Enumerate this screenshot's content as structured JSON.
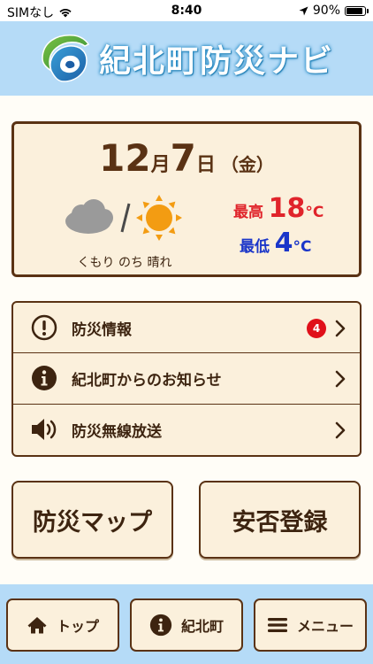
{
  "status_bar": {
    "carrier": "SIMなし",
    "time": "8:40",
    "battery": "90%",
    "battery_level": 0.9
  },
  "header": {
    "title": "紀北町防災ナビ"
  },
  "weather": {
    "month": "12",
    "month_suffix": "月",
    "day": "7",
    "day_suffix": "日",
    "weekday": "（金）",
    "description": "くもり のち 晴れ",
    "high_label": "最高",
    "high_value": "18",
    "high_unit": "°C",
    "low_label": "最低",
    "low_value": "4",
    "low_unit": "°C",
    "icons": [
      "cloud-icon",
      "sun-icon"
    ]
  },
  "menu": {
    "items": [
      {
        "label": "防災情報",
        "icon": "exclamation-circle-icon",
        "badge": "4"
      },
      {
        "label": "紀北町からのお知らせ",
        "icon": "info-circle-icon"
      },
      {
        "label": "防災無線放送",
        "icon": "speaker-icon"
      }
    ]
  },
  "buttons": {
    "map": "防災マップ",
    "safety": "安否登録"
  },
  "footer": {
    "top": "トップ",
    "town": "紀北町",
    "menu": "メニュー"
  },
  "colors": {
    "header_bg": "#b5dbf7",
    "border_brown": "#5a3214",
    "card_bg": "#fbf0dc",
    "high_red": "#e0242b",
    "low_blue": "#1b36c9",
    "badge_red": "#e0101a"
  }
}
